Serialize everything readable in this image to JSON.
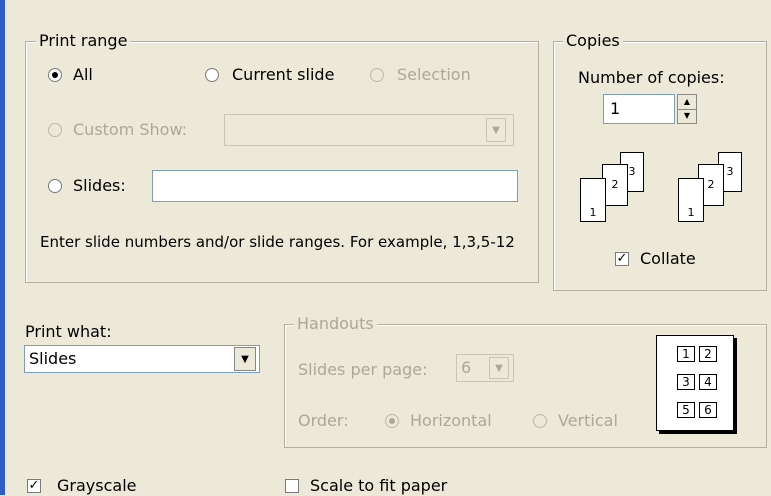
{
  "print_range": {
    "title": "Print range",
    "all_label": "All",
    "current_slide_label": "Current slide",
    "selection_label": "Selection",
    "custom_show_label": "Custom Show:",
    "slides_label": "Slides:",
    "slides_value": "",
    "hint": "Enter slide numbers and/or slide ranges. For example, 1,3,5-12",
    "selected": "All"
  },
  "copies": {
    "title": "Copies",
    "number_label": "Number of copies:",
    "number_value": "1",
    "collate_label": "Collate",
    "collate_checked": true,
    "stack_pages": [
      "1",
      "2",
      "3"
    ]
  },
  "print_what": {
    "label": "Print what:",
    "value": "Slides"
  },
  "handouts": {
    "title": "Handouts",
    "slides_per_page_label": "Slides per page:",
    "slides_per_page_value": "6",
    "order_label": "Order:",
    "horizontal_label": "Horizontal",
    "vertical_label": "Vertical",
    "order_selected": "Horizontal",
    "preview_cells": [
      "1",
      "2",
      "3",
      "4",
      "5",
      "6"
    ]
  },
  "options": {
    "grayscale_label": "Grayscale",
    "grayscale_checked": true,
    "scale_label": "Scale to fit paper",
    "scale_checked": false
  },
  "icons": {
    "checkmark": "✓",
    "dropdown": "▼",
    "spin_up": "▲",
    "spin_down": "▼"
  }
}
